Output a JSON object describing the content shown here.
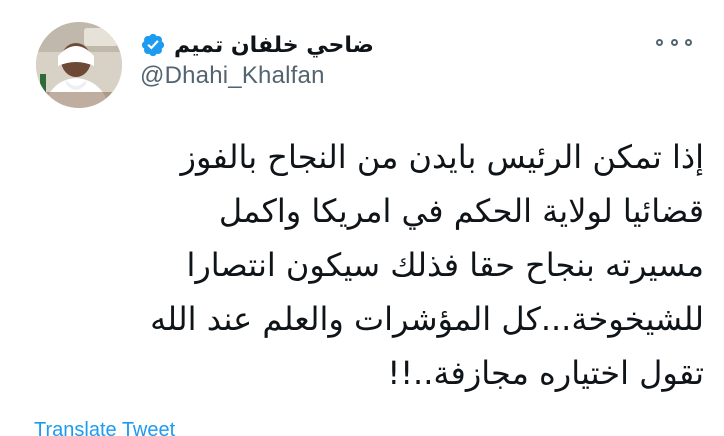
{
  "tweet": {
    "author": {
      "display_name": "ضاحي خلفان تميم",
      "handle": "@Dhahi_Khalfan",
      "verified_icon": "verified-badge-icon",
      "avatar": "profile-photo"
    },
    "more_icon": "more-options-icon",
    "body_lines": [
      "إذا تمكن الرئيس بايدن من النجاح بالفوز",
      "قضائيا لولاية الحكم في امريكا واكمل",
      "مسيرته بنجاح حقا فذلك سيكون انتصارا",
      "للشيخوخة...كل المؤشرات والعلم عند الله",
      "تقول  اختياره مجازفة..!!"
    ],
    "translate_label": "Translate Tweet"
  },
  "colors": {
    "text": "#0f1419",
    "secondary": "#536471",
    "accent": "#1d9bf0"
  }
}
